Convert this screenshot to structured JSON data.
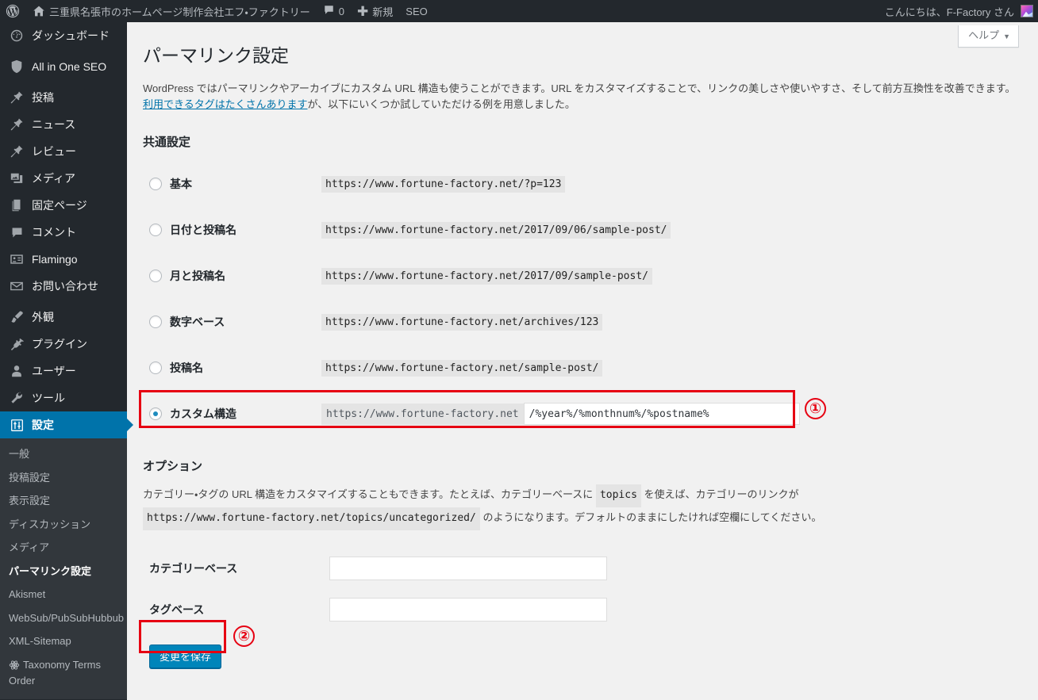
{
  "adminbar": {
    "logo_icon": "wordpress-logo-icon",
    "home_icon": "home-icon",
    "site_name": "三重県名張市のホームページ制作会社エフ・ファクトリー",
    "comments_icon": "comment-bubble-icon",
    "comments_count": "0",
    "new_icon": "plus-icon",
    "new_label": "新規",
    "seo_label": "SEO",
    "howdy": "こんにちは、F-Factory さん",
    "avatar_icon": "user-avatar"
  },
  "sidebar": {
    "items": [
      {
        "label": "ダッシュボード",
        "icon": "dashboard-gauge-icon",
        "current": false
      },
      {
        "label": "All in One SEO",
        "icon": "shield-icon",
        "current": false
      },
      {
        "label": "投稿",
        "icon": "pushpin-icon",
        "current": false
      },
      {
        "label": "ニュース",
        "icon": "pushpin-icon",
        "current": false
      },
      {
        "label": "レビュー",
        "icon": "pushpin-icon",
        "current": false
      },
      {
        "label": "メディア",
        "icon": "media-photo-icon",
        "current": false
      },
      {
        "label": "固定ページ",
        "icon": "pages-icon",
        "current": false
      },
      {
        "label": "コメント",
        "icon": "comment-bubble-icon",
        "current": false
      },
      {
        "label": "Flamingo",
        "icon": "contact-card-icon",
        "current": false
      },
      {
        "label": "お問い合わせ",
        "icon": "envelope-icon",
        "current": false
      },
      {
        "label": "外観",
        "icon": "paintbrush-icon",
        "current": false
      },
      {
        "label": "プラグイン",
        "icon": "plug-icon",
        "current": false
      },
      {
        "label": "ユーザー",
        "icon": "user-icon",
        "current": false
      },
      {
        "label": "ツール",
        "icon": "wrench-icon",
        "current": false
      },
      {
        "label": "設定",
        "icon": "settings-sliders-icon",
        "current": true
      }
    ],
    "submenu": [
      {
        "label": "一般",
        "current": false,
        "icon": null
      },
      {
        "label": "投稿設定",
        "current": false,
        "icon": null
      },
      {
        "label": "表示設定",
        "current": false,
        "icon": null
      },
      {
        "label": "ディスカッション",
        "current": false,
        "icon": null
      },
      {
        "label": "メディア",
        "current": false,
        "icon": null
      },
      {
        "label": "パーマリンク設定",
        "current": true,
        "icon": null
      },
      {
        "label": "Akismet",
        "current": false,
        "icon": null
      },
      {
        "label": "WebSub/PubSubHubbub",
        "current": false,
        "icon": null
      },
      {
        "label": "XML-Sitemap",
        "current": false,
        "icon": null
      },
      {
        "label": "Taxonomy Terms Order",
        "current": false,
        "icon": "atom-icon"
      }
    ]
  },
  "help_tab": {
    "label": "ヘルプ",
    "caret_icon": "chevron-down-icon"
  },
  "page": {
    "title": "パーマリンク設定",
    "description_part1": "WordPress ではパーマリンクやアーカイブにカスタム URL 構造も使うことができます。URL をカスタマイズすることで、リンクの美しさや使いやすさ、そして前方互換性を改善できます。",
    "description_link": "利用できるタグはたくさんあります",
    "description_part2": "が、以下にいくつか試していただける例を用意しました。"
  },
  "common_settings": {
    "heading": "共通設定",
    "options": [
      {
        "label": "基本",
        "example": "https://www.fortune-factory.net/?p=123",
        "selected": false
      },
      {
        "label": "日付と投稿名",
        "example": "https://www.fortune-factory.net/2017/09/06/sample-post/",
        "selected": false
      },
      {
        "label": "月と投稿名",
        "example": "https://www.fortune-factory.net/2017/09/sample-post/",
        "selected": false
      },
      {
        "label": "数字ベース",
        "example": "https://www.fortune-factory.net/archives/123",
        "selected": false
      },
      {
        "label": "投稿名",
        "example": "https://www.fortune-factory.net/sample-post/",
        "selected": false
      }
    ],
    "custom": {
      "label": "カスタム構造",
      "selected": true,
      "prefix": "https://www.fortune-factory.net",
      "value": "/%year%/%monthnum%/%postname%"
    }
  },
  "options_section": {
    "heading": "オプション",
    "desc_1": "カテゴリー・タグの URL 構造をカスタマイズすることもできます。たとえば、カテゴリーベースに",
    "desc_code_1": "topics",
    "desc_2": "を使えば、カテゴリーのリンクが",
    "desc_code_2": "https://www.fortune-factory.net/topics/uncategorized/",
    "desc_3": "のようになります。デフォルトのままにしたければ空欄にしてください。",
    "category_base_label": "カテゴリーベース",
    "category_base_value": "",
    "tag_base_label": "タグベース",
    "tag_base_value": ""
  },
  "submit": {
    "save_label": "変更を保存"
  },
  "annotations": [
    {
      "number": "①",
      "target": "custom-structure-row"
    },
    {
      "number": "②",
      "target": "save-button"
    }
  ],
  "colors": {
    "admin_blue": "#0073aa",
    "button_blue": "#0085ba",
    "annotation_red": "#e60012",
    "sidebar_dark": "#23282d",
    "submenu_dark": "#32373c"
  }
}
